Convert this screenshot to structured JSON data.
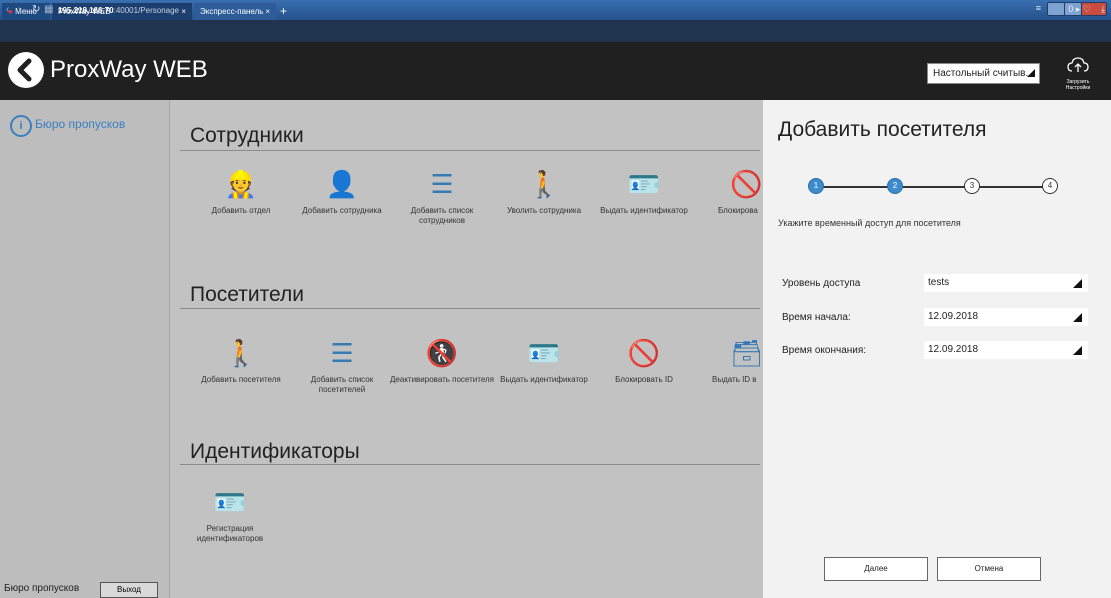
{
  "browser": {
    "menu_label": "Меню",
    "tabs": [
      {
        "label": "ProxWay WEB",
        "close": "×"
      },
      {
        "label": "Экспресс-панель",
        "close": "×"
      }
    ],
    "new_tab": "+",
    "address_host": "195.218.166.70",
    "address_path": ":40001/Personage",
    "address_right": "0 ▸ ♡"
  },
  "header": {
    "title": "ProxWay WEB",
    "reader_select": "Настольный считыв...",
    "upload_label": "Загрузить Настройки"
  },
  "sidebar": {
    "item_label": "Бюро пропусков",
    "footer_label": "Бюро пропусков",
    "logout_label": "Выход"
  },
  "sections": [
    {
      "title": "Сотрудники",
      "tiles": [
        {
          "label": "Добавить отдел",
          "icon": "👷"
        },
        {
          "label": "Добавить сотрудника",
          "icon": "👤"
        },
        {
          "label": "Добавить список сотрудников",
          "icon": "☰"
        },
        {
          "label": "Уволить сотрудника",
          "icon": "🚶"
        },
        {
          "label": "Выдать идентификатор",
          "icon": "🪪"
        },
        {
          "label": "Блокирова",
          "icon": "🚫"
        }
      ]
    },
    {
      "title": "Посетители",
      "tiles": [
        {
          "label": "Добавить посетителя",
          "icon": "🚶"
        },
        {
          "label": "Добавить список посетителей",
          "icon": "☰"
        },
        {
          "label": "Деактивировать посетителя",
          "icon": "🚷"
        },
        {
          "label": "Выдать идентификатор",
          "icon": "🪪"
        },
        {
          "label": "Блокировать ID",
          "icon": "🚫"
        },
        {
          "label": "Выдать ID в",
          "icon": "🗃"
        }
      ]
    },
    {
      "title": "Идентификаторы",
      "tiles": [
        {
          "label": "Регистрация идентификаторов",
          "icon": "🪪"
        }
      ]
    }
  ],
  "panel": {
    "title": "Добавить посетителя",
    "steps": [
      "1",
      "2",
      "3",
      "4"
    ],
    "active_steps": 2,
    "subtitle": "Укажите временный доступ для посетителя",
    "fields": [
      {
        "label": "Уровень доступа",
        "value": "tests"
      },
      {
        "label": "Время начала:",
        "value": "12.09.2018"
      },
      {
        "label": "Время окончания:",
        "value": "12.09.2018"
      }
    ],
    "next_label": "Далее",
    "cancel_label": "Отмена"
  },
  "colors": {
    "accent": "#3d8bcc",
    "header_bg": "#202020",
    "panel_bg": "#f2f2f2",
    "main_bg": "#c2c2c2"
  }
}
